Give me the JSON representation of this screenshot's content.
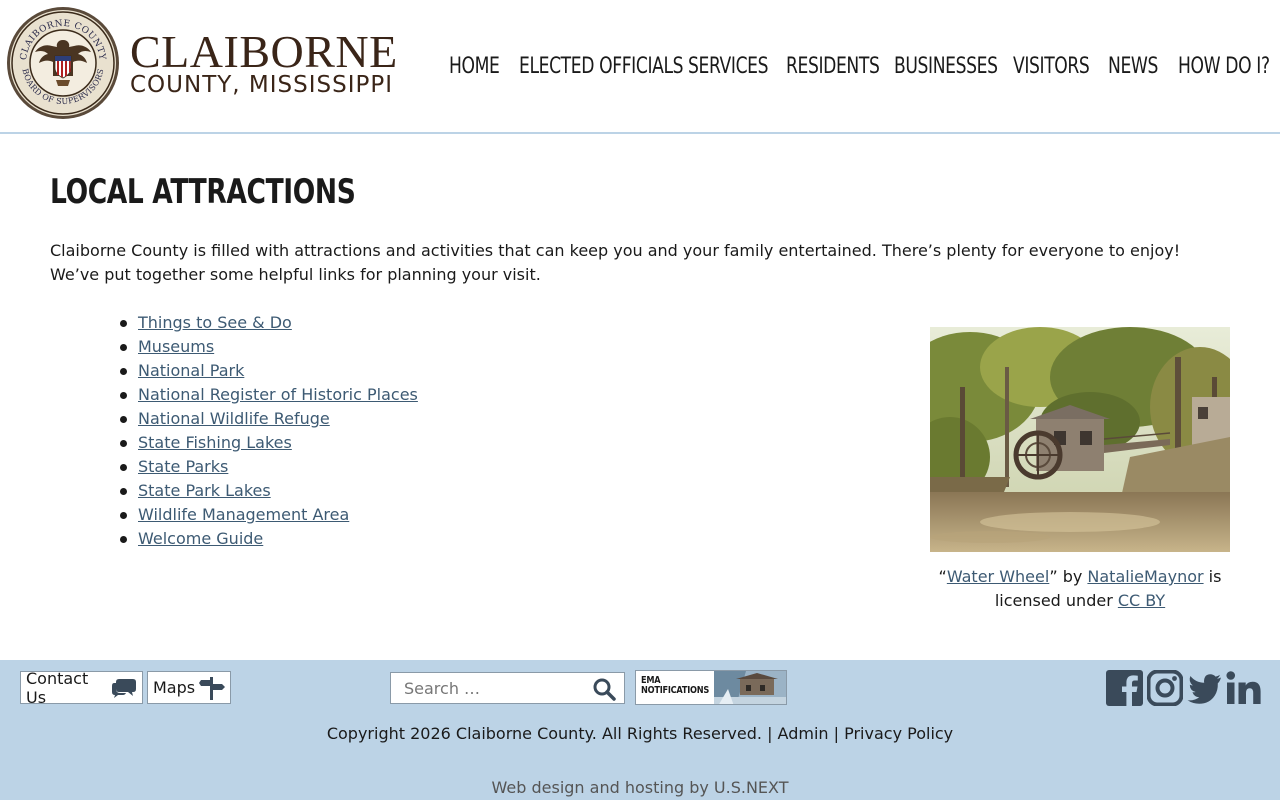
{
  "header": {
    "brand_line1": "CLAIBORNE",
    "brand_line2": "COUNTY, MISSISSIPPI",
    "seal_text_top": "CLAIBORNE COUNTY",
    "seal_text_bottom": "BOARD OF SUPERVISORS",
    "nav": [
      {
        "label": "HOME"
      },
      {
        "label": "ELECTED OFFICIALS"
      },
      {
        "label": "SERVICES"
      },
      {
        "label": "RESIDENTS"
      },
      {
        "label": "BUSINESSES"
      },
      {
        "label": "VISITORS"
      },
      {
        "label": "NEWS"
      },
      {
        "label": "HOW DO I?"
      }
    ]
  },
  "main": {
    "title": "LOCAL ATTRACTIONS",
    "intro": "Claiborne County is filled with attractions and activities that can keep you and your family entertained. There’s plenty for everyone to enjoy! We’ve put together some helpful links for planning your visit.",
    "links": [
      "Things to See & Do",
      "Museums",
      "National Park",
      "National Register of Historic Places",
      "National Wildlife Refuge",
      "State Fishing Lakes",
      "State Parks",
      "State Park Lakes",
      "Wildlife Management Area",
      "Welcome Guide"
    ],
    "caption": {
      "open_quote": "“",
      "title_link": "Water Wheel",
      "by_text": "” by ",
      "author_link": "NatalieMaynor",
      "licensed_text": " is licensed under ",
      "license_link": "CC BY"
    }
  },
  "footer": {
    "contact_label": "Contact Us",
    "maps_label": "Maps",
    "search_placeholder": "Search …",
    "ema_line1": "EMA",
    "ema_line2": "NOTIFICATIONS",
    "copyright_text": "Copyright 2026 Claiborne County. All Rights Reserved.",
    "separator": " | ",
    "admin_label": "Admin",
    "privacy_label": "Privacy Policy",
    "credit_text": "Web design and hosting by U.S.NEXT"
  },
  "colors": {
    "brand_brown": "#3a2518",
    "link_blue": "#3d5a73",
    "footer_bg": "#bcd3e6",
    "social_icon": "#3a4a5a"
  },
  "icons": {
    "contact": "speech-bubbles-icon",
    "maps": "signpost-icon",
    "search": "magnifier-icon",
    "social": [
      "facebook-icon",
      "instagram-icon",
      "twitter-icon",
      "linkedin-icon"
    ]
  }
}
